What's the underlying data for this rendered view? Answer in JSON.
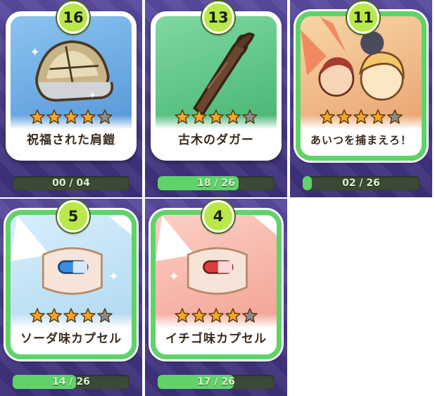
{
  "cards": [
    {
      "level": "16",
      "name": "祝福された肩鎧",
      "stars": 4,
      "max_stars": 5,
      "progress_text": "00 / 04",
      "progress": 0.0,
      "art": "shoulder-armor-icon",
      "bg": "#6fa8e0"
    },
    {
      "level": "13",
      "name": "古木のダガー",
      "stars": 4,
      "max_stars": 5,
      "progress_text": "18 / 26",
      "progress": 0.69,
      "art": "wooden-dagger-icon",
      "bg": "#5fc48a"
    },
    {
      "level": "11",
      "name": "あいつを捕まえろ！",
      "stars": 4,
      "max_stars": 5,
      "progress_text": "02 / 26",
      "progress": 0.08,
      "art": "chase-scene-art",
      "bg": "#f0c088"
    },
    {
      "level": "5",
      "name": "ソーダ味カプセル",
      "stars": 4,
      "max_stars": 5,
      "progress_text": "14 / 26",
      "progress": 0.54,
      "art": "soda-capsule-icon",
      "bg": "#bfe3f5"
    },
    {
      "level": "4",
      "name": "イチゴ味カプセル",
      "stars": 4,
      "max_stars": 5,
      "progress_text": "17 / 26",
      "progress": 0.65,
      "art": "strawberry-capsule-icon",
      "bg": "#f7b3a8"
    }
  ],
  "colors": {
    "star_filled": "#f5a623",
    "star_empty": "#8c8c8c",
    "bar_fill": "#5fd36a",
    "badge": "#b8e84a"
  }
}
